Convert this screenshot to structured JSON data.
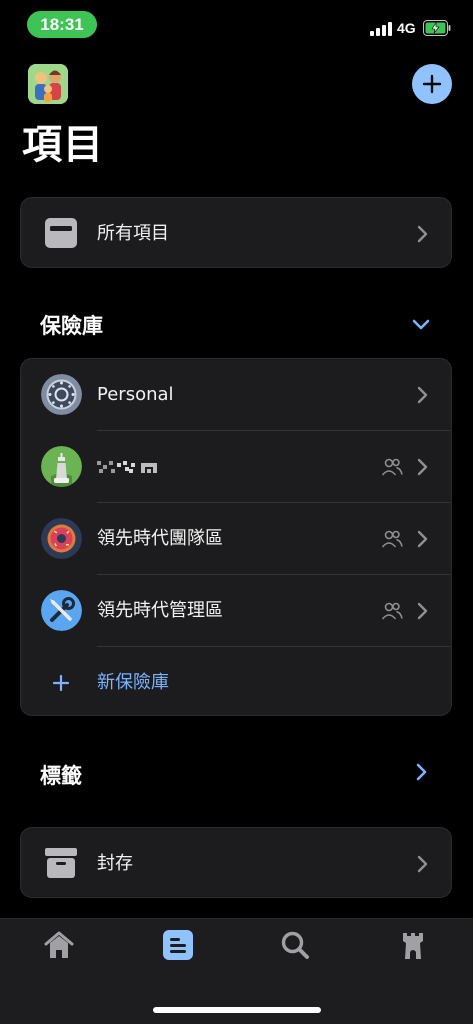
{
  "status": {
    "time": "18:31",
    "network": "4G"
  },
  "header": {
    "title": "項目"
  },
  "all_items": {
    "label": "所有項目"
  },
  "vaults": {
    "title": "保險庫",
    "items": [
      {
        "label": "Personal",
        "shared": false
      },
      {
        "label": "",
        "shared": true
      },
      {
        "label": "領先時代團隊區",
        "shared": true
      },
      {
        "label": "領先時代管理區",
        "shared": true
      }
    ],
    "new_vault": "新保險庫"
  },
  "tags": {
    "title": "標籤"
  },
  "archive": {
    "label": "封存"
  },
  "tabbar": {
    "active": "items"
  },
  "colors": {
    "accent": "#90c2ff",
    "link": "#7ab3ff",
    "card": "#1c1c1e",
    "status_green": "#3ec454"
  }
}
